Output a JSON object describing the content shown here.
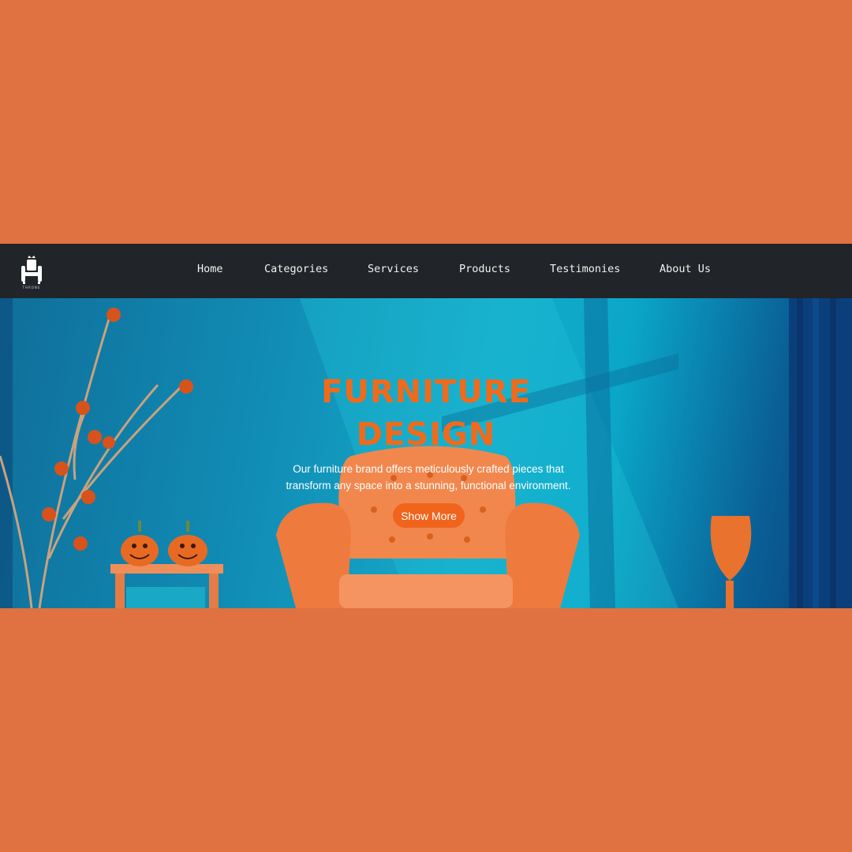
{
  "logo": {
    "icon": "throne-chair-icon",
    "text": "THRONE"
  },
  "nav": {
    "items": [
      {
        "label": "Home"
      },
      {
        "label": "Categories"
      },
      {
        "label": "Services"
      },
      {
        "label": "Products"
      },
      {
        "label": "Testimonies"
      },
      {
        "label": "About Us"
      }
    ]
  },
  "hero": {
    "title_line1": "FURNITURE",
    "title_line2": "DESIGN",
    "text_line1": "Our furniture brand offers meticulously crafted pieces that",
    "text_line2": "transform any space into a stunning, functional environment.",
    "button_label": "Show More"
  },
  "colors": {
    "page_background": "#df7240",
    "navbar_background": "#212428",
    "accent": "#f06a1c",
    "hero_blue": "#15a9c9"
  }
}
